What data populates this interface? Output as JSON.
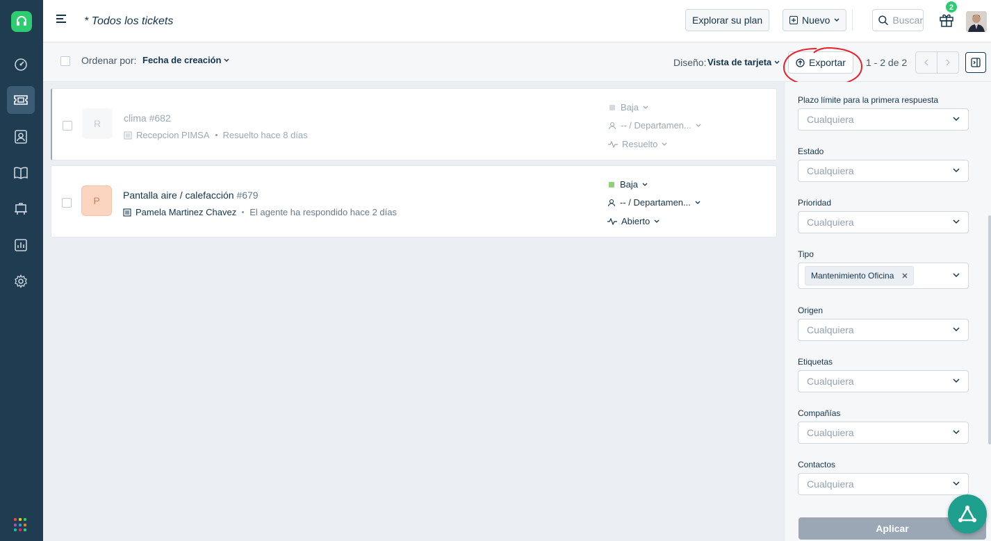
{
  "header": {
    "title": "* Todos los tickets",
    "explore_plan": "Explorar su plan",
    "new_label": "Nuevo",
    "search_placeholder": "Buscar",
    "notification_count": "2"
  },
  "toolbar": {
    "sort_label": "Ordenar por:",
    "sort_value": "Fecha de creación",
    "layout_label": "Diseño:",
    "layout_value": "Vista de tarjeta",
    "export_label": "Exportar",
    "pagination": "1 - 2 de 2"
  },
  "tickets": [
    {
      "avatar_letter": "R",
      "avatar_color": "#f5f7f9",
      "subject": "clima",
      "number": "#682",
      "requester": "Recepcion PIMSA",
      "status_text": "Resuelto hace 8 días",
      "priority": "Baja",
      "priority_color": "#d3d9de",
      "assignee": "-- / Departamen...",
      "status": "Resuelto"
    },
    {
      "avatar_letter": "P",
      "avatar_color": "#fcd5c0",
      "subject": "Pantalla aire / calefacción",
      "number": "#679",
      "requester": "Pamela Martinez Chavez",
      "status_text": "El agente ha respondido hace 2 días",
      "priority": "Baja",
      "priority_color": "#8ed27b",
      "assignee": "-- / Departamen...",
      "status": "Abierto"
    }
  ],
  "filters": {
    "first_response": {
      "label": "Plazo límite para la primera respuesta",
      "value": "Cualquiera"
    },
    "status": {
      "label": "Estado",
      "value": "Cualquiera"
    },
    "priority": {
      "label": "Prioridad",
      "value": "Cualquiera"
    },
    "type": {
      "label": "Tipo",
      "tag": "Mantenimiento Oficina"
    },
    "source": {
      "label": "Origen",
      "value": "Cualquiera"
    },
    "tags": {
      "label": "Etiquetas",
      "value": "Cualquiera"
    },
    "companies": {
      "label": "Compañías",
      "value": "Cualquiera"
    },
    "contacts": {
      "label": "Contactos",
      "value": "Cualquiera"
    },
    "apply_label": "Aplicar"
  },
  "colors": {
    "sidebar": "#1f3c50",
    "brand_green": "#2ecc71",
    "annotation_red": "#e8202a"
  }
}
